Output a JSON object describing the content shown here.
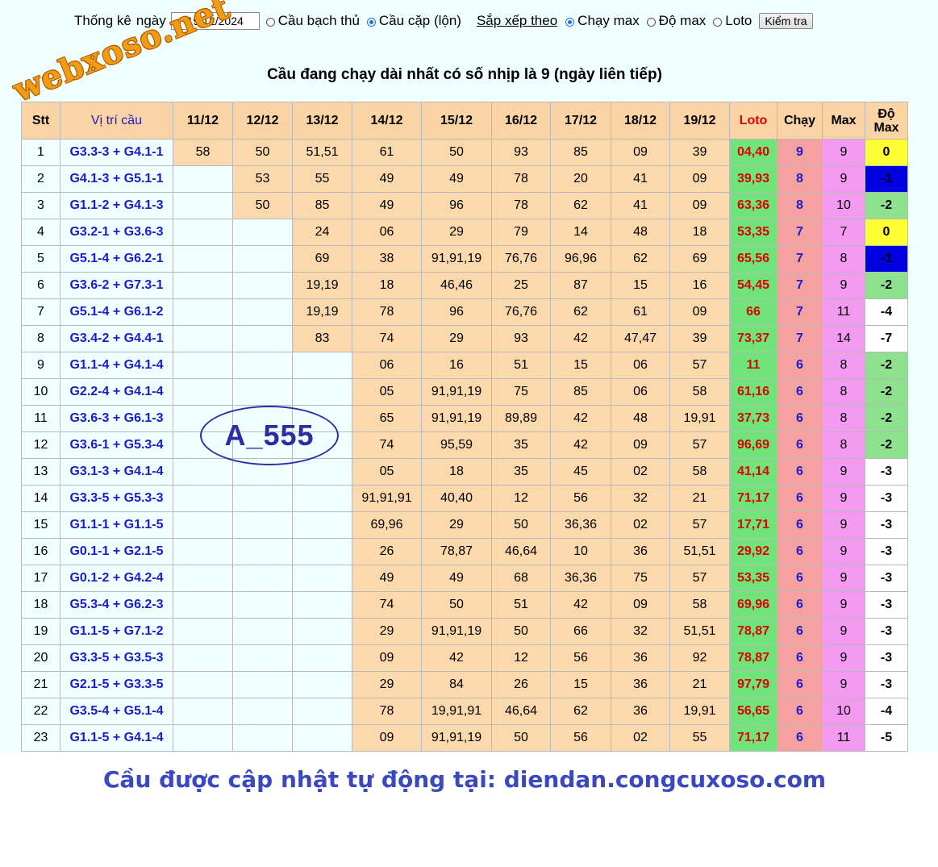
{
  "watermark": "webxoso.net",
  "controls": {
    "stats_label": "Thống kê",
    "date_label": "ngày",
    "date_value": "19/12/2024",
    "type_options": [
      {
        "label": "Cầu bạch thủ",
        "checked": false
      },
      {
        "label": "Cầu cặp (lộn)",
        "checked": true
      }
    ],
    "sort_label": "Sắp xếp theo",
    "sort_options": [
      {
        "label": "Chạy max",
        "checked": true
      },
      {
        "label": "Độ max",
        "checked": false
      },
      {
        "label": "Loto",
        "checked": false
      }
    ],
    "check_button": "Kiểm tra"
  },
  "heading": "Cầu đang chạy dài nhất có số nhịp là 9 (ngày liên tiếp)",
  "table": {
    "headers": [
      "Stt",
      "Vị trí cầu",
      "11/12",
      "12/12",
      "13/12",
      "14/12",
      "15/12",
      "16/12",
      "17/12",
      "18/12",
      "19/12",
      "Loto",
      "Chạy",
      "Max",
      "Độ Max"
    ],
    "rows": [
      {
        "stt": "1",
        "pos": "G3.3-3 + G4.1-1",
        "start": 0,
        "days": [
          "58",
          "50",
          "51,51",
          "61",
          "50",
          "93",
          "85",
          "09",
          "39"
        ],
        "loto": "04,40",
        "chay": "9",
        "max": "9",
        "do": "0",
        "do_color": "yellow"
      },
      {
        "stt": "2",
        "pos": "G4.1-3 + G5.1-1",
        "start": 1,
        "days": [
          "",
          "53",
          "55",
          "49",
          "49",
          "78",
          "20",
          "41",
          "09"
        ],
        "loto": "39,93",
        "chay": "8",
        "max": "9",
        "do": "-1",
        "do_color": "blue"
      },
      {
        "stt": "3",
        "pos": "G1.1-2 + G4.1-3",
        "start": 1,
        "days": [
          "",
          "50",
          "85",
          "49",
          "96",
          "78",
          "62",
          "41",
          "09"
        ],
        "loto": "63,36",
        "chay": "8",
        "max": "10",
        "do": "-2",
        "do_color": "green"
      },
      {
        "stt": "4",
        "pos": "G3.2-1 + G3.6-3",
        "start": 2,
        "days": [
          "",
          "",
          "24",
          "06",
          "29",
          "79",
          "14",
          "48",
          "18"
        ],
        "loto": "53,35",
        "chay": "7",
        "max": "7",
        "do": "0",
        "do_color": "yellow"
      },
      {
        "stt": "5",
        "pos": "G5.1-4 + G6.2-1",
        "start": 2,
        "days": [
          "",
          "",
          "69",
          "38",
          "91,91,19",
          "76,76",
          "96,96",
          "62",
          "69"
        ],
        "loto": "65,56",
        "chay": "7",
        "max": "8",
        "do": "-1",
        "do_color": "blue"
      },
      {
        "stt": "6",
        "pos": "G3.6-2 + G7.3-1",
        "start": 2,
        "days": [
          "",
          "",
          "19,19",
          "18",
          "46,46",
          "25",
          "87",
          "15",
          "16"
        ],
        "loto": "54,45",
        "chay": "7",
        "max": "9",
        "do": "-2",
        "do_color": "green"
      },
      {
        "stt": "7",
        "pos": "G5.1-4 + G6.1-2",
        "start": 2,
        "days": [
          "",
          "",
          "19,19",
          "78",
          "96",
          "76,76",
          "62",
          "61",
          "09"
        ],
        "loto": "66",
        "chay": "7",
        "max": "11",
        "do": "-4",
        "do_color": "white"
      },
      {
        "stt": "8",
        "pos": "G3.4-2 + G4.4-1",
        "start": 2,
        "days": [
          "",
          "",
          "83",
          "74",
          "29",
          "93",
          "42",
          "47,47",
          "39"
        ],
        "loto": "73,37",
        "chay": "7",
        "max": "14",
        "do": "-7",
        "do_color": "white"
      },
      {
        "stt": "9",
        "pos": "G1.1-4 + G4.1-4",
        "start": 3,
        "days": [
          "",
          "",
          "",
          "06",
          "16",
          "51",
          "15",
          "06",
          "57"
        ],
        "loto": "11",
        "chay": "6",
        "max": "8",
        "do": "-2",
        "do_color": "green"
      },
      {
        "stt": "10",
        "pos": "G2.2-4 + G4.1-4",
        "start": 3,
        "days": [
          "",
          "",
          "",
          "05",
          "91,91,19",
          "75",
          "85",
          "06",
          "58"
        ],
        "loto": "61,16",
        "chay": "6",
        "max": "8",
        "do": "-2",
        "do_color": "green"
      },
      {
        "stt": "11",
        "pos": "G3.6-3 + G6.1-3",
        "start": 3,
        "days": [
          "",
          "",
          "",
          "65",
          "91,91,19",
          "89,89",
          "42",
          "48",
          "19,91"
        ],
        "loto": "37,73",
        "chay": "6",
        "max": "8",
        "do": "-2",
        "do_color": "green"
      },
      {
        "stt": "12",
        "pos": "G3.6-1 + G5.3-4",
        "start": 3,
        "days": [
          "",
          "",
          "",
          "74",
          "95,59",
          "35",
          "42",
          "09",
          "57"
        ],
        "loto": "96,69",
        "chay": "6",
        "max": "8",
        "do": "-2",
        "do_color": "green"
      },
      {
        "stt": "13",
        "pos": "G3.1-3 + G4.1-4",
        "start": 3,
        "days": [
          "",
          "",
          "",
          "05",
          "18",
          "35",
          "45",
          "02",
          "58"
        ],
        "loto": "41,14",
        "chay": "6",
        "max": "9",
        "do": "-3",
        "do_color": "white"
      },
      {
        "stt": "14",
        "pos": "G3.3-5 + G5.3-3",
        "start": 3,
        "days": [
          "",
          "",
          "",
          "91,91,91",
          "40,40",
          "12",
          "56",
          "32",
          "21"
        ],
        "loto": "71,17",
        "chay": "6",
        "max": "9",
        "do": "-3",
        "do_color": "white"
      },
      {
        "stt": "15",
        "pos": "G1.1-1 + G1.1-5",
        "start": 3,
        "days": [
          "",
          "",
          "",
          "69,96",
          "29",
          "50",
          "36,36",
          "02",
          "57"
        ],
        "loto": "17,71",
        "chay": "6",
        "max": "9",
        "do": "-3",
        "do_color": "white"
      },
      {
        "stt": "16",
        "pos": "G0.1-1 + G2.1-5",
        "start": 3,
        "days": [
          "",
          "",
          "",
          "26",
          "78,87",
          "46,64",
          "10",
          "36",
          "51,51"
        ],
        "loto": "29,92",
        "chay": "6",
        "max": "9",
        "do": "-3",
        "do_color": "white"
      },
      {
        "stt": "17",
        "pos": "G0.1-2 + G4.2-4",
        "start": 3,
        "days": [
          "",
          "",
          "",
          "49",
          "49",
          "68",
          "36,36",
          "75",
          "57"
        ],
        "loto": "53,35",
        "chay": "6",
        "max": "9",
        "do": "-3",
        "do_color": "white"
      },
      {
        "stt": "18",
        "pos": "G5.3-4 + G6.2-3",
        "start": 3,
        "days": [
          "",
          "",
          "",
          "74",
          "50",
          "51",
          "42",
          "09",
          "58"
        ],
        "loto": "69,96",
        "chay": "6",
        "max": "9",
        "do": "-3",
        "do_color": "white"
      },
      {
        "stt": "19",
        "pos": "G1.1-5 + G7.1-2",
        "start": 3,
        "days": [
          "",
          "",
          "",
          "29",
          "91,91,19",
          "50",
          "66",
          "32",
          "51,51"
        ],
        "loto": "78,87",
        "chay": "6",
        "max": "9",
        "do": "-3",
        "do_color": "white"
      },
      {
        "stt": "20",
        "pos": "G3.3-5 + G3.5-3",
        "start": 3,
        "days": [
          "",
          "",
          "",
          "09",
          "42",
          "12",
          "56",
          "36",
          "92"
        ],
        "loto": "78,87",
        "chay": "6",
        "max": "9",
        "do": "-3",
        "do_color": "white"
      },
      {
        "stt": "21",
        "pos": "G2.1-5 + G3.3-5",
        "start": 3,
        "days": [
          "",
          "",
          "",
          "29",
          "84",
          "26",
          "15",
          "36",
          "21"
        ],
        "loto": "97,79",
        "chay": "6",
        "max": "9",
        "do": "-3",
        "do_color": "white"
      },
      {
        "stt": "22",
        "pos": "G3.5-4 + G5.1-4",
        "start": 3,
        "days": [
          "",
          "",
          "",
          "78",
          "19,91,91",
          "46,64",
          "62",
          "36",
          "19,91"
        ],
        "loto": "56,65",
        "chay": "6",
        "max": "10",
        "do": "-4",
        "do_color": "white"
      },
      {
        "stt": "23",
        "pos": "G1.1-5 + G4.1-4",
        "start": 3,
        "days": [
          "",
          "",
          "",
          "09",
          "91,91,19",
          "50",
          "56",
          "02",
          "55"
        ],
        "loto": "71,17",
        "chay": "6",
        "max": "11",
        "do": "-5",
        "do_color": "white"
      }
    ]
  },
  "stamp": "A_555",
  "footer": "Cầu được cập nhật tự động tại: diendan.congcuxoso.com",
  "colors": {
    "header_bg": "#fbd4a6",
    "filled_cell_bg": "#fbd9ac",
    "loto_bg": "#70e47a",
    "chay_bg": "#f6a1a1",
    "max_bg": "#f49af0",
    "do_yellow": "#ffff33",
    "do_blue": "#0000e0",
    "do_green": "#8ee28e",
    "position_text": "#1a1ad0",
    "loto_text": "#e00000"
  }
}
